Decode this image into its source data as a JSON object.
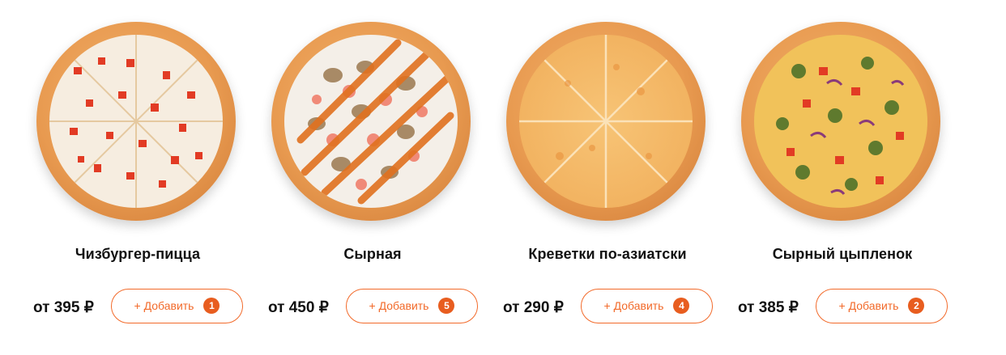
{
  "products": [
    {
      "name": "Чизбургер-пицца",
      "price": "от 395 ₽",
      "add_label": "+ Добавить",
      "count": "1",
      "topping": "cheeseburger"
    },
    {
      "name": "Сырная",
      "price": "от 450 ₽",
      "add_label": "+ Добавить",
      "count": "5",
      "topping": "shrimp-mushroom"
    },
    {
      "name": "Креветки по-азиатски",
      "price": "от 290 ₽",
      "add_label": "+ Добавить",
      "count": "4",
      "topping": "cheese"
    },
    {
      "name": "Сырный цыпленок",
      "price": "от 385 ₽",
      "add_label": "+ Добавить",
      "count": "2",
      "topping": "chicken-pickles"
    }
  ],
  "colors": {
    "accent": "#f26a2a",
    "badge": "#e85d1f",
    "text": "#111111"
  }
}
